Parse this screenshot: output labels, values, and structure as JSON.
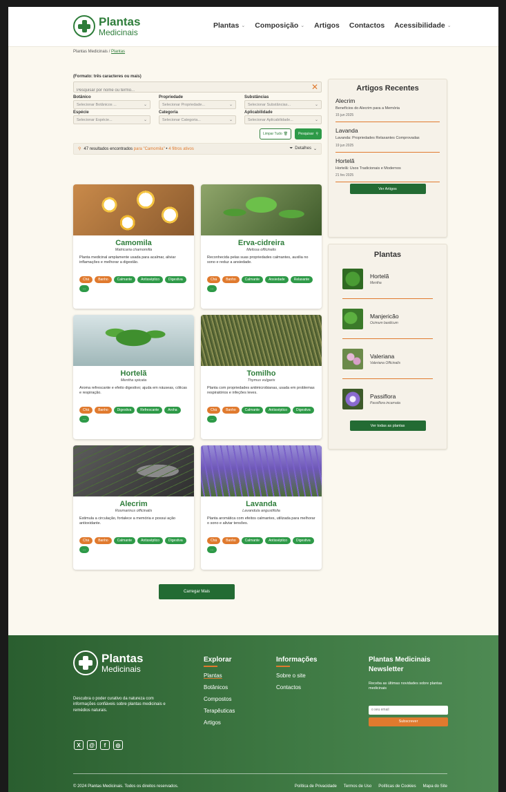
{
  "brand": {
    "name_line1": "Plantas",
    "name_line2": "Medicinais"
  },
  "nav": [
    {
      "label": "Plantas",
      "dropdown": true
    },
    {
      "label": "Composição",
      "dropdown": true
    },
    {
      "label": "Artigos",
      "dropdown": false
    },
    {
      "label": "Contactos",
      "dropdown": false
    },
    {
      "label": "Acessibilidade",
      "dropdown": true
    }
  ],
  "breadcrumb": {
    "root": "Plantas Medicinais",
    "separator": "/",
    "current": "Plantas"
  },
  "search": {
    "format_hint": "(Formato: três caracteres ou mais)",
    "placeholder": "Pesquisar por nome ou termo...",
    "filters": [
      {
        "label": "Botânico",
        "placeholder": "Selecionar Botânicos ..."
      },
      {
        "label": "Propriedade",
        "placeholder": "Selecionar Propriedade..."
      },
      {
        "label": "Substâncias",
        "placeholder": "Selecionar Substâncias..."
      },
      {
        "label": "Espécie",
        "placeholder": "Selecionar Espécie..."
      },
      {
        "label": "Categoria",
        "placeholder": "Selecionar Categoria..."
      },
      {
        "label": "Aplicabilidade",
        "placeholder": "Selecionar Aplicabilidade..."
      }
    ],
    "clear_label": "Limpar Tudo",
    "search_label": "Pesquisar",
    "results_count": "47 resultados encontrados",
    "results_query": "para \"Camomila\"",
    "results_bullet": "•",
    "results_filters": "4 filtros ativos",
    "details_label": "Detalhes"
  },
  "plants": [
    {
      "name": "Camomila",
      "scientific": "Matricaria chamomilla",
      "description": "Planta medicinal amplamente usada para acalmar, aliviar inflamações e melhorar a digestão.",
      "tags": [
        {
          "text": "Chá",
          "c": "o"
        },
        {
          "text": "Banho",
          "c": "o"
        },
        {
          "text": "Calmante",
          "c": "g"
        },
        {
          "text": "Antisséptico",
          "c": "g"
        },
        {
          "text": "Digestiva",
          "c": "g"
        },
        {
          "text": "...",
          "c": "g"
        }
      ]
    },
    {
      "name": "Erva-cidreira",
      "scientific": "Melissa officinalis",
      "description": "Reconhecida pelas suas propriedades calmantes, auxilia no sono e reduz a ansiedade.",
      "tags": [
        {
          "text": "Chá",
          "c": "o"
        },
        {
          "text": "Banho",
          "c": "o"
        },
        {
          "text": "Calmante",
          "c": "g"
        },
        {
          "text": "Ansiedade",
          "c": "g"
        },
        {
          "text": "Relaxante",
          "c": "g"
        },
        {
          "text": "...",
          "c": "g"
        }
      ]
    },
    {
      "name": "Hortelã",
      "scientific": "Mentha spicata",
      "description": "Aroma refrescante e efeito digestivo; ajuda em náuseas, cólicas e respiração.",
      "tags": [
        {
          "text": "Chá",
          "c": "o"
        },
        {
          "text": "Banho",
          "c": "o"
        },
        {
          "text": "Digestiva",
          "c": "g"
        },
        {
          "text": "Refrescante",
          "c": "g"
        },
        {
          "text": "Aroha",
          "c": "g"
        },
        {
          "text": "...",
          "c": "g"
        }
      ]
    },
    {
      "name": "Tomilho",
      "scientific": "Thymus vulgaris",
      "description": "Planta com propriedades antimicrobianas, usada em problemas respiratórios e infeções leves.",
      "tags": [
        {
          "text": "Chá",
          "c": "o"
        },
        {
          "text": "Banho",
          "c": "o"
        },
        {
          "text": "Calmante",
          "c": "g"
        },
        {
          "text": "Antisséptico",
          "c": "g"
        },
        {
          "text": "Digestiva",
          "c": "g"
        },
        {
          "text": "...",
          "c": "g"
        }
      ]
    },
    {
      "name": "Alecrim",
      "scientific": "Rosmarinus officinalis",
      "description": "Estimula a circulação, fortalece a memória e possui ação antioxidante.",
      "tags": [
        {
          "text": "Chá",
          "c": "o"
        },
        {
          "text": "Banho",
          "c": "o"
        },
        {
          "text": "Calmante",
          "c": "g"
        },
        {
          "text": "Antisséptico",
          "c": "g"
        },
        {
          "text": "Digestiva",
          "c": "g"
        },
        {
          "text": "...",
          "c": "g"
        }
      ]
    },
    {
      "name": "Lavanda",
      "scientific": "Lavandula angustifolia",
      "description": "Planta aromática com efeitos calmantes, utilizada para melhorar o sono e aliviar tensões.",
      "tags": [
        {
          "text": "Chá",
          "c": "o"
        },
        {
          "text": "Banho",
          "c": "o"
        },
        {
          "text": "Calmante",
          "c": "g"
        },
        {
          "text": "Antisséptico",
          "c": "g"
        },
        {
          "text": "Digestiva",
          "c": "g"
        },
        {
          "text": "...",
          "c": "g"
        }
      ]
    }
  ],
  "load_more_label": "Carregar Mais",
  "recent_articles": {
    "title": "Artigos Recentes",
    "items": [
      {
        "title": "Alecrim",
        "subtitle": "Benefícios do Alecrim para a Memória",
        "date": "15 jun 2025"
      },
      {
        "title": "Lavanda",
        "subtitle": "Lavanda: Propriedades Relaxantes Comprovadas",
        "date": "19 jun 2025"
      },
      {
        "title": "Hortelã",
        "subtitle": "Hortelã: Usos Tradicionais e Modernos",
        "date": "21 fev 2025"
      }
    ],
    "button_label": "Ver Artigos"
  },
  "sidebar_plants": {
    "title": "Plantas",
    "items": [
      {
        "name": "Hortelã",
        "scientific": "Mentha"
      },
      {
        "name": "Manjericão",
        "scientific": "Ocimum basilicum"
      },
      {
        "name": "Valeriana",
        "scientific": "Valeriana Officinalis"
      },
      {
        "name": "Passiflora",
        "scientific": "Passiflora incarnata"
      }
    ],
    "button_label": "Ver todas as plantas"
  },
  "footer": {
    "description": "Descubra o poder curativo da natureza com informações confiáveis sobre plantas medicinais e remédios naturais.",
    "socials": [
      "X",
      "@",
      "f",
      "◎"
    ],
    "explore": {
      "title": "Explorar",
      "links": [
        "Plantas",
        "Botânicos",
        "Compostos",
        "Terapêuticas",
        "Artigos"
      ]
    },
    "info": {
      "title": "Informações",
      "links": [
        "Sobre o site",
        "Contactos"
      ]
    },
    "newsletter": {
      "title_line1": "Plantas Medicinais",
      "title_line2": "Newsletter",
      "description": "Receba as últimas novidades sobre plantas medicinais",
      "email_placeholder": "o seu email",
      "button_label": "Subscrever"
    },
    "copyright": "© 2024 Plantas Medicinais. Todos os direitos reservados.",
    "legal_links": [
      "Política de Privacidade",
      "Termos de Uso",
      "Políticas de Cookies",
      "Mapa do Site"
    ]
  },
  "colors": {
    "primary_green": "#2e7d3a",
    "accent_orange": "#e07a2e",
    "tag_green": "#2e9a48",
    "footer_green": "#2a5e2f",
    "page_bg": "#fbf8ef"
  }
}
